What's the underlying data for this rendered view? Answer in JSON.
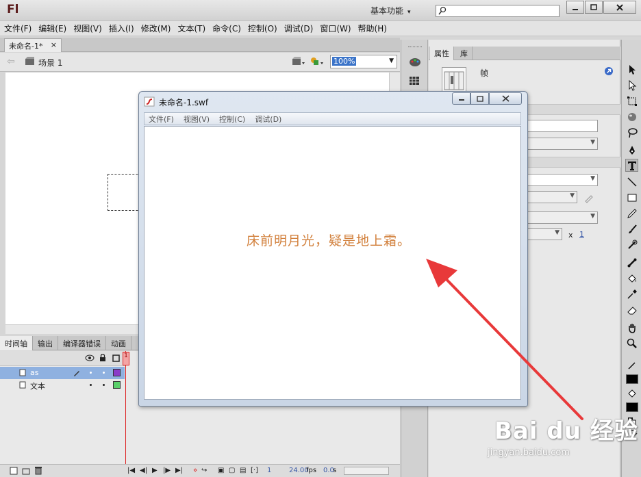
{
  "app": {
    "logo": "Fl",
    "workspace": "基本功能",
    "search": {
      "placeholder": "",
      "value": ""
    }
  },
  "menu": [
    "文件(F)",
    "编辑(E)",
    "视图(V)",
    "插入(I)",
    "修改(M)",
    "文本(T)",
    "命令(C)",
    "控制(O)",
    "调试(D)",
    "窗口(W)",
    "帮助(H)"
  ],
  "document_tab": {
    "label": "未命名-1*",
    "close": "×"
  },
  "edit_bar": {
    "scene": "场景 1",
    "zoom": "100%"
  },
  "timeline": {
    "tabs": [
      "时间轴",
      "输出",
      "编译器错误",
      "动画"
    ],
    "playhead_frame": "1",
    "layers": [
      {
        "name": "as",
        "color": "#8a3cc8",
        "selected": true
      },
      {
        "name": "文本",
        "color": "#5ad06a",
        "selected": false
      }
    ],
    "footer": {
      "current_frame": "1",
      "fps": "24.00",
      "fps_unit": "fps",
      "time": "0.0",
      "time_unit": "s"
    }
  },
  "properties": {
    "tabs": [
      "属性",
      "库"
    ],
    "frame_label": "帧",
    "x_label": "x",
    "x_value": "1"
  },
  "swf_window": {
    "title": "未命名-1.swf",
    "menu": [
      "文件(F)",
      "视图(V)",
      "控制(C)",
      "调试(D)"
    ],
    "poem": "床前明月光，疑是地上霜。"
  },
  "watermark": {
    "text": "Bai du 经验",
    "url": "jingyan.baidu.com"
  },
  "colors": {
    "annotation_arrow": "#e8393a",
    "poem_text": "#d2803c",
    "playhead": "#dd2222"
  }
}
